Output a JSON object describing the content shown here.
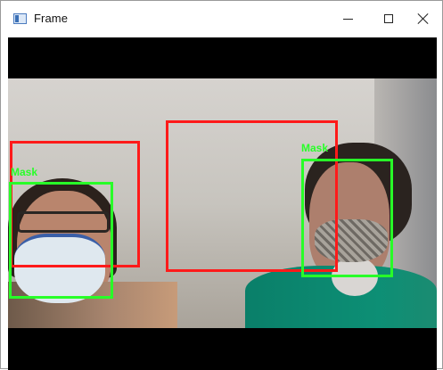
{
  "window": {
    "title": "Frame",
    "icons": {
      "app": "app-window-icon",
      "minimize": "minimize-icon",
      "maximize": "maximize-icon",
      "close": "close-icon"
    }
  },
  "detections": [
    {
      "label": ""
    },
    {
      "label": "Mask"
    },
    {
      "label": ""
    },
    {
      "label": "Mask"
    }
  ],
  "colors": {
    "no_mask_box": "#ff1a1a",
    "mask_box": "#28ff28"
  }
}
